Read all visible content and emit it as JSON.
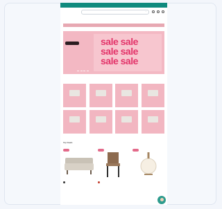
{
  "topbar": {
    "promo": "",
    "links": [
      "",
      ""
    ]
  },
  "header": {
    "logo": "",
    "search_placeholder": ""
  },
  "nav": [
    "",
    "",
    "",
    "",
    "",
    "",
    "",
    ""
  ],
  "breadcrumb": "",
  "promo_strip": "",
  "hero": {
    "eyebrow": "",
    "headline": "",
    "button": "",
    "sale_words": [
      "sale sale",
      "sale sale",
      "sale sale"
    ]
  },
  "categories": [
    "",
    "",
    "",
    "",
    "",
    "",
    "",
    ""
  ],
  "products_section": {
    "title": "Top Deals",
    "more": ""
  },
  "products": [
    {
      "badge": "",
      "name": "",
      "price": ""
    },
    {
      "badge": "",
      "name": "",
      "price": ""
    },
    {
      "badge": "",
      "name": "",
      "price": ""
    }
  ],
  "colors": {
    "accent": "#0f8a7e",
    "sale_pink": "#e3346a",
    "tile_pink": "#f2b6c1"
  }
}
